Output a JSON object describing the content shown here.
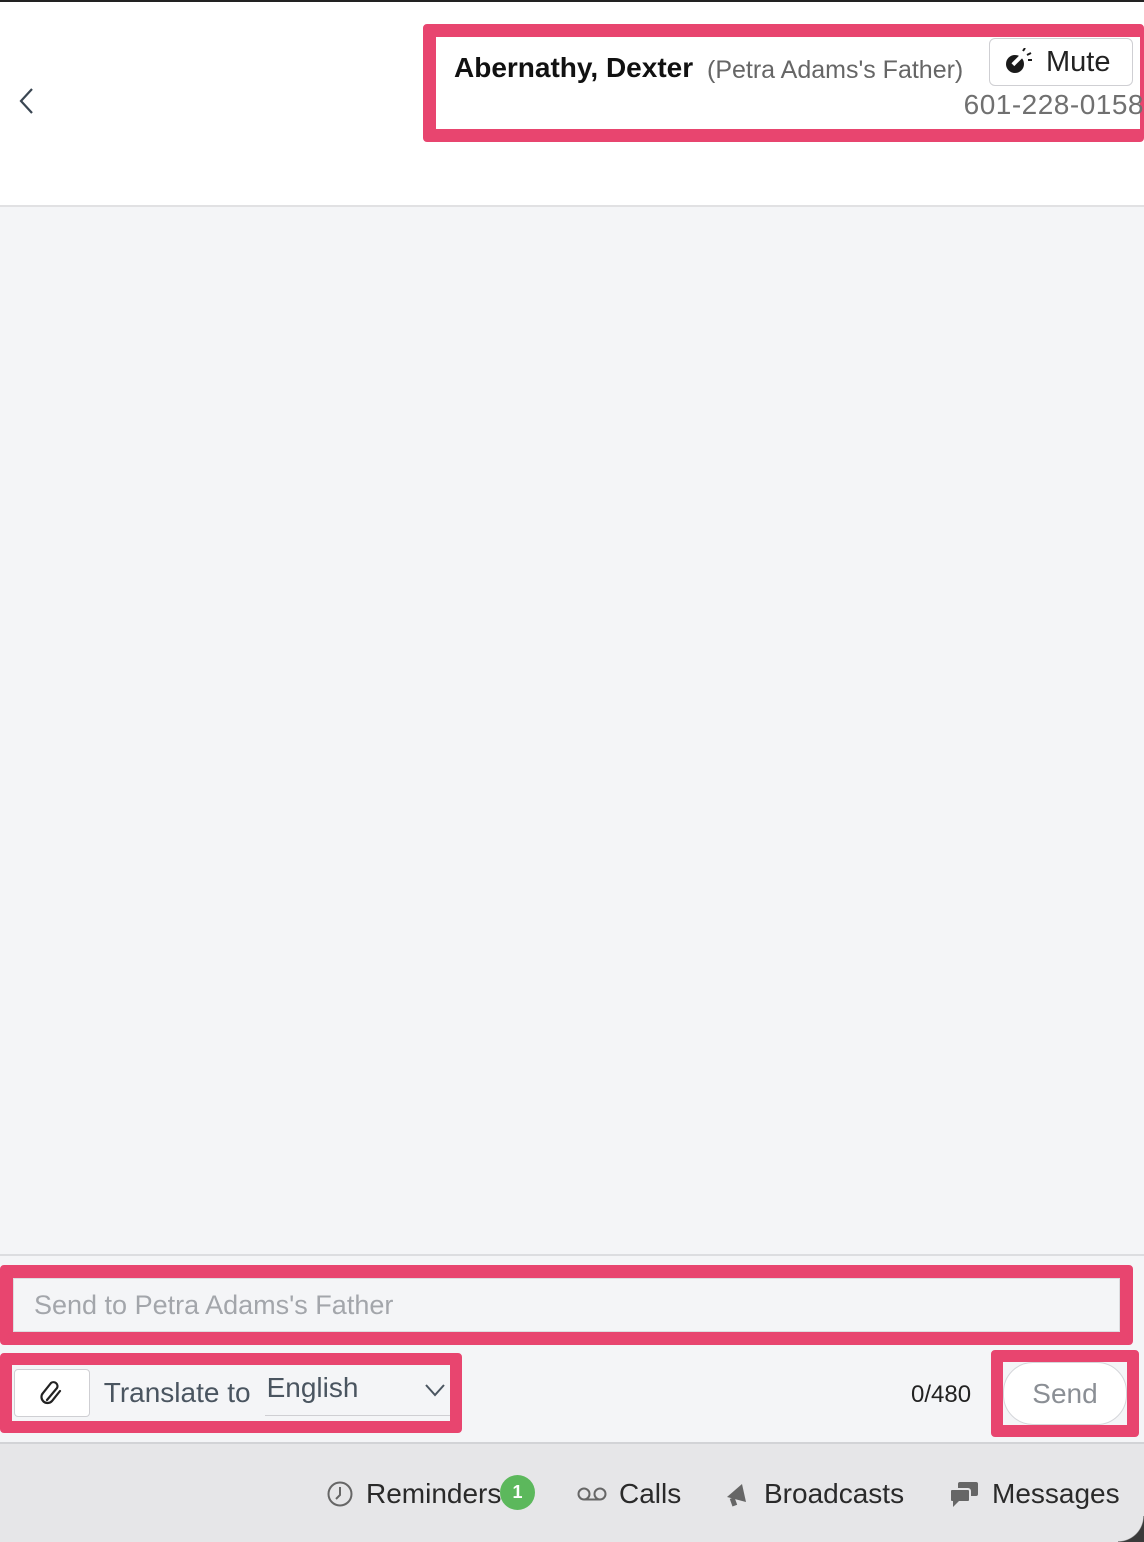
{
  "header": {
    "contact": {
      "name": "Abernathy, Dexter",
      "relation": "(Petra Adams's Father)",
      "phone": "601-228-0158"
    },
    "mute_label": "Mute"
  },
  "composer": {
    "placeholder": "Send to Petra Adams's Father",
    "translate_label": "Translate to",
    "language": "English",
    "counter": "0/480",
    "send_label": "Send"
  },
  "bottom_nav": {
    "items": [
      {
        "label": "Reminders",
        "icon": "clock-icon",
        "badge": "1"
      },
      {
        "label": "Calls",
        "icon": "voicemail-icon"
      },
      {
        "label": "Broadcasts",
        "icon": "megaphone-icon"
      },
      {
        "label": "Messages",
        "icon": "chat-bubbles-icon"
      }
    ]
  },
  "colors": {
    "highlight": "#e8456f",
    "badge": "#5cb85c",
    "background": "#f4f5f7"
  }
}
